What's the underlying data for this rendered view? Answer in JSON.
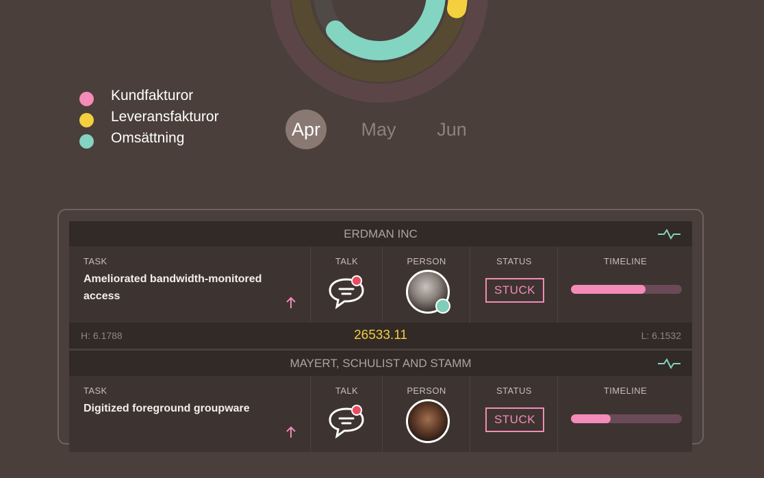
{
  "colors": {
    "pink": "#f48bb8",
    "yellow": "#f4d03f",
    "teal": "#84d4c2"
  },
  "ring_chart": {
    "rings": [
      {
        "series": "Kundfakturor",
        "color": "#f48bb8",
        "value_fraction": 0.0
      },
      {
        "series": "Leveransfakturor",
        "color": "#f4d03f",
        "value_fraction": 0.28
      },
      {
        "series": "Omsättning",
        "color": "#84d4c2",
        "value_fraction": 0.64
      }
    ]
  },
  "legend": [
    {
      "label": "Kundfakturor",
      "color": "#f48bb8"
    },
    {
      "label": "Leveransfakturor",
      "color": "#f4d03f"
    },
    {
      "label": "Omsättning",
      "color": "#84d4c2"
    }
  ],
  "months": [
    {
      "label": "Apr",
      "active": true
    },
    {
      "label": "May",
      "active": false
    },
    {
      "label": "Jun",
      "active": false
    }
  ],
  "columns": {
    "task": "TASK",
    "talk": "TALK",
    "person": "PERSON",
    "status": "STATUS",
    "timeline": "TIMELINE"
  },
  "groups": [
    {
      "title": "ERDMAN INC",
      "task": "Ameliorated bandwidth-monitored access",
      "status": "STUCK",
      "timeline_progress": 0.67,
      "footer_low": "H: 6.1788",
      "footer_value": "26533.11",
      "footer_high": "L: 6.1532"
    },
    {
      "title": "MAYERT, SCHULIST AND STAMM",
      "task": "Digitized foreground groupware",
      "status": "STUCK",
      "timeline_progress": 0.36
    }
  ]
}
